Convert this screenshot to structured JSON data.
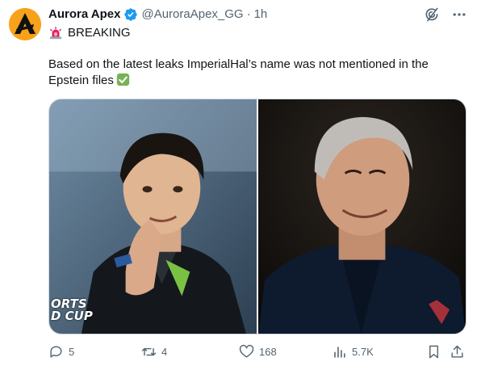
{
  "author": {
    "display_name": "Aurora Apex",
    "handle": "@AuroraApex_GG",
    "separator": "·",
    "time": "1h"
  },
  "tweet": {
    "line1": "BREAKING",
    "body": "Based on the latest leaks ImperialHal’s name was not mentioned in the Epstein files"
  },
  "media": {
    "left_photo_text": [
      "ORTS",
      "D CUP"
    ]
  },
  "actions": {
    "replies": "5",
    "retweets": "4",
    "likes": "168",
    "views": "5.7K"
  },
  "colors": {
    "accent": "#1d9bf0",
    "secondary_text": "#536471",
    "brand": "#f7a21a"
  },
  "icons": {
    "verified": "verified-badge-icon",
    "siren": "rotating-light-icon",
    "check": "check-mark-button-icon",
    "grok": "grok-icon",
    "more": "more-icon",
    "reply": "reply-icon",
    "retweet": "retweet-icon",
    "like": "heart-icon",
    "views": "views-icon",
    "bookmark": "bookmark-icon",
    "share": "share-icon"
  }
}
